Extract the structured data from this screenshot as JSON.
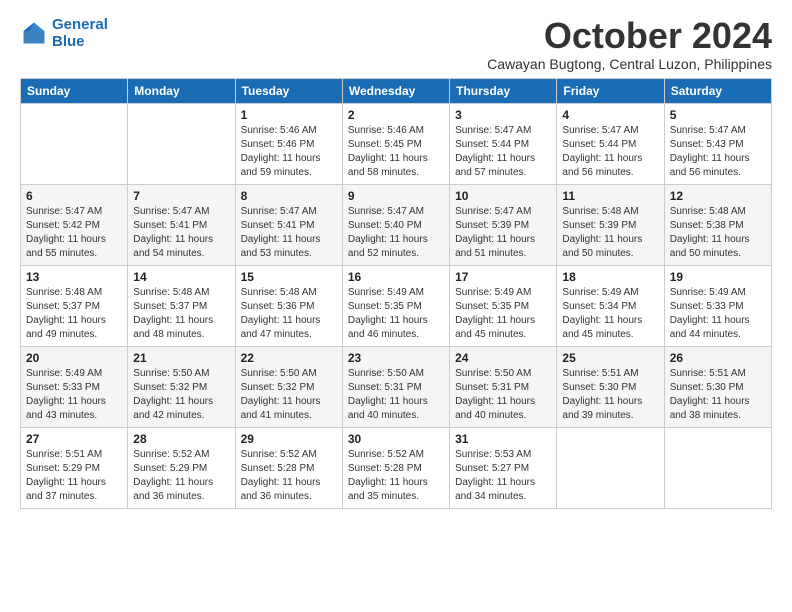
{
  "logo": {
    "line1": "General",
    "line2": "Blue"
  },
  "title": "October 2024",
  "subtitle": "Cawayan Bugtong, Central Luzon, Philippines",
  "days_header": [
    "Sunday",
    "Monday",
    "Tuesday",
    "Wednesday",
    "Thursday",
    "Friday",
    "Saturday"
  ],
  "weeks": [
    [
      {
        "day": "",
        "info": ""
      },
      {
        "day": "",
        "info": ""
      },
      {
        "day": "1",
        "info": "Sunrise: 5:46 AM\nSunset: 5:46 PM\nDaylight: 11 hours and 59 minutes."
      },
      {
        "day": "2",
        "info": "Sunrise: 5:46 AM\nSunset: 5:45 PM\nDaylight: 11 hours and 58 minutes."
      },
      {
        "day": "3",
        "info": "Sunrise: 5:47 AM\nSunset: 5:44 PM\nDaylight: 11 hours and 57 minutes."
      },
      {
        "day": "4",
        "info": "Sunrise: 5:47 AM\nSunset: 5:44 PM\nDaylight: 11 hours and 56 minutes."
      },
      {
        "day": "5",
        "info": "Sunrise: 5:47 AM\nSunset: 5:43 PM\nDaylight: 11 hours and 56 minutes."
      }
    ],
    [
      {
        "day": "6",
        "info": "Sunrise: 5:47 AM\nSunset: 5:42 PM\nDaylight: 11 hours and 55 minutes."
      },
      {
        "day": "7",
        "info": "Sunrise: 5:47 AM\nSunset: 5:41 PM\nDaylight: 11 hours and 54 minutes."
      },
      {
        "day": "8",
        "info": "Sunrise: 5:47 AM\nSunset: 5:41 PM\nDaylight: 11 hours and 53 minutes."
      },
      {
        "day": "9",
        "info": "Sunrise: 5:47 AM\nSunset: 5:40 PM\nDaylight: 11 hours and 52 minutes."
      },
      {
        "day": "10",
        "info": "Sunrise: 5:47 AM\nSunset: 5:39 PM\nDaylight: 11 hours and 51 minutes."
      },
      {
        "day": "11",
        "info": "Sunrise: 5:48 AM\nSunset: 5:39 PM\nDaylight: 11 hours and 50 minutes."
      },
      {
        "day": "12",
        "info": "Sunrise: 5:48 AM\nSunset: 5:38 PM\nDaylight: 11 hours and 50 minutes."
      }
    ],
    [
      {
        "day": "13",
        "info": "Sunrise: 5:48 AM\nSunset: 5:37 PM\nDaylight: 11 hours and 49 minutes."
      },
      {
        "day": "14",
        "info": "Sunrise: 5:48 AM\nSunset: 5:37 PM\nDaylight: 11 hours and 48 minutes."
      },
      {
        "day": "15",
        "info": "Sunrise: 5:48 AM\nSunset: 5:36 PM\nDaylight: 11 hours and 47 minutes."
      },
      {
        "day": "16",
        "info": "Sunrise: 5:49 AM\nSunset: 5:35 PM\nDaylight: 11 hours and 46 minutes."
      },
      {
        "day": "17",
        "info": "Sunrise: 5:49 AM\nSunset: 5:35 PM\nDaylight: 11 hours and 45 minutes."
      },
      {
        "day": "18",
        "info": "Sunrise: 5:49 AM\nSunset: 5:34 PM\nDaylight: 11 hours and 45 minutes."
      },
      {
        "day": "19",
        "info": "Sunrise: 5:49 AM\nSunset: 5:33 PM\nDaylight: 11 hours and 44 minutes."
      }
    ],
    [
      {
        "day": "20",
        "info": "Sunrise: 5:49 AM\nSunset: 5:33 PM\nDaylight: 11 hours and 43 minutes."
      },
      {
        "day": "21",
        "info": "Sunrise: 5:50 AM\nSunset: 5:32 PM\nDaylight: 11 hours and 42 minutes."
      },
      {
        "day": "22",
        "info": "Sunrise: 5:50 AM\nSunset: 5:32 PM\nDaylight: 11 hours and 41 minutes."
      },
      {
        "day": "23",
        "info": "Sunrise: 5:50 AM\nSunset: 5:31 PM\nDaylight: 11 hours and 40 minutes."
      },
      {
        "day": "24",
        "info": "Sunrise: 5:50 AM\nSunset: 5:31 PM\nDaylight: 11 hours and 40 minutes."
      },
      {
        "day": "25",
        "info": "Sunrise: 5:51 AM\nSunset: 5:30 PM\nDaylight: 11 hours and 39 minutes."
      },
      {
        "day": "26",
        "info": "Sunrise: 5:51 AM\nSunset: 5:30 PM\nDaylight: 11 hours and 38 minutes."
      }
    ],
    [
      {
        "day": "27",
        "info": "Sunrise: 5:51 AM\nSunset: 5:29 PM\nDaylight: 11 hours and 37 minutes."
      },
      {
        "day": "28",
        "info": "Sunrise: 5:52 AM\nSunset: 5:29 PM\nDaylight: 11 hours and 36 minutes."
      },
      {
        "day": "29",
        "info": "Sunrise: 5:52 AM\nSunset: 5:28 PM\nDaylight: 11 hours and 36 minutes."
      },
      {
        "day": "30",
        "info": "Sunrise: 5:52 AM\nSunset: 5:28 PM\nDaylight: 11 hours and 35 minutes."
      },
      {
        "day": "31",
        "info": "Sunrise: 5:53 AM\nSunset: 5:27 PM\nDaylight: 11 hours and 34 minutes."
      },
      {
        "day": "",
        "info": ""
      },
      {
        "day": "",
        "info": ""
      }
    ]
  ]
}
